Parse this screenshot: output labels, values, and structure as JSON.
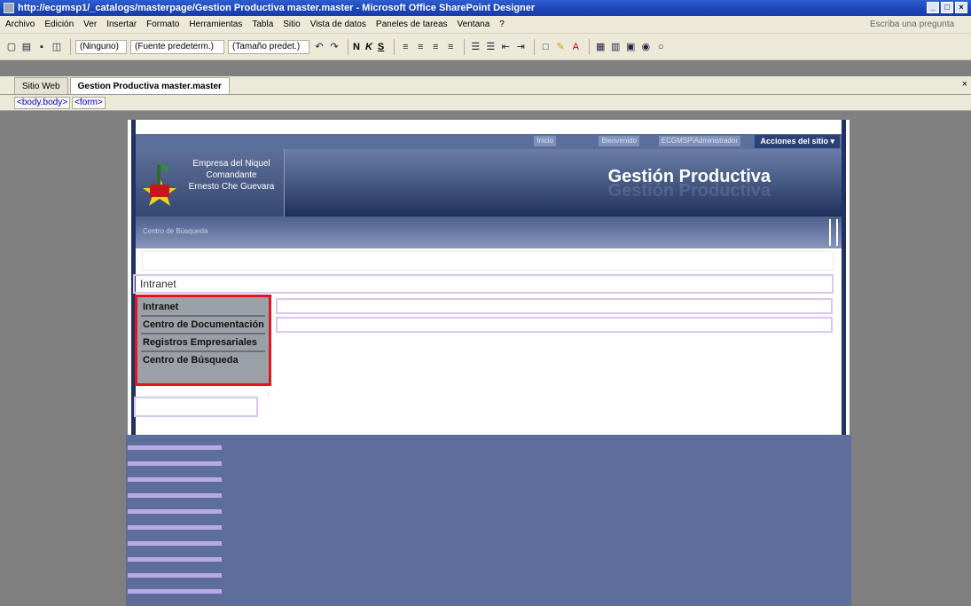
{
  "window": {
    "title": "http://ecgmsp1/_catalogs/masterpage/Gestion Productiva master.master - Microsoft Office SharePoint Designer",
    "controls": [
      "_",
      "□",
      "×"
    ]
  },
  "menu": {
    "items": [
      "Archivo",
      "Edición",
      "Ver",
      "Insertar",
      "Formato",
      "Herramientas",
      "Tabla",
      "Sitio",
      "Vista de datos",
      "Paneles de tareas",
      "Ventana",
      "?"
    ],
    "ask_placeholder": "Escriba una pregunta"
  },
  "toolbar": {
    "style_combo": "(Ninguno)",
    "font_combo": "(Fuente predeterm.)",
    "size_combo": "(Tamaño predet.)",
    "bold": "N",
    "italic": "K",
    "underline": "S"
  },
  "tabs": {
    "site": "Sitio Web",
    "file": "Gestion Productiva master.master",
    "close": "×"
  },
  "tag_selector": [
    "<body.body>",
    "<form>"
  ],
  "page": {
    "topnav": {
      "links": [
        "Inicio",
        "Bienvenido",
        "ECGMSP\\Administrador"
      ],
      "actions": "Acciones del sitio ▾"
    },
    "org_lines": [
      "Empresa del Niquel",
      "Comandante",
      "Ernesto Che Guevara"
    ],
    "site_title": "Gestión Productiva",
    "search_label": "Centro de Búsqueda",
    "breadcrumb": "Intranet",
    "quicklaunch": [
      "Intranet",
      "Centro de Documentación",
      "Registros Empresariales",
      "Centro de Búsqueda"
    ]
  },
  "colors": {
    "titlebar": "#1c43b8",
    "banner": "#41557f",
    "highlight_border": "#e3161f",
    "footer": "#5d6d9c"
  }
}
